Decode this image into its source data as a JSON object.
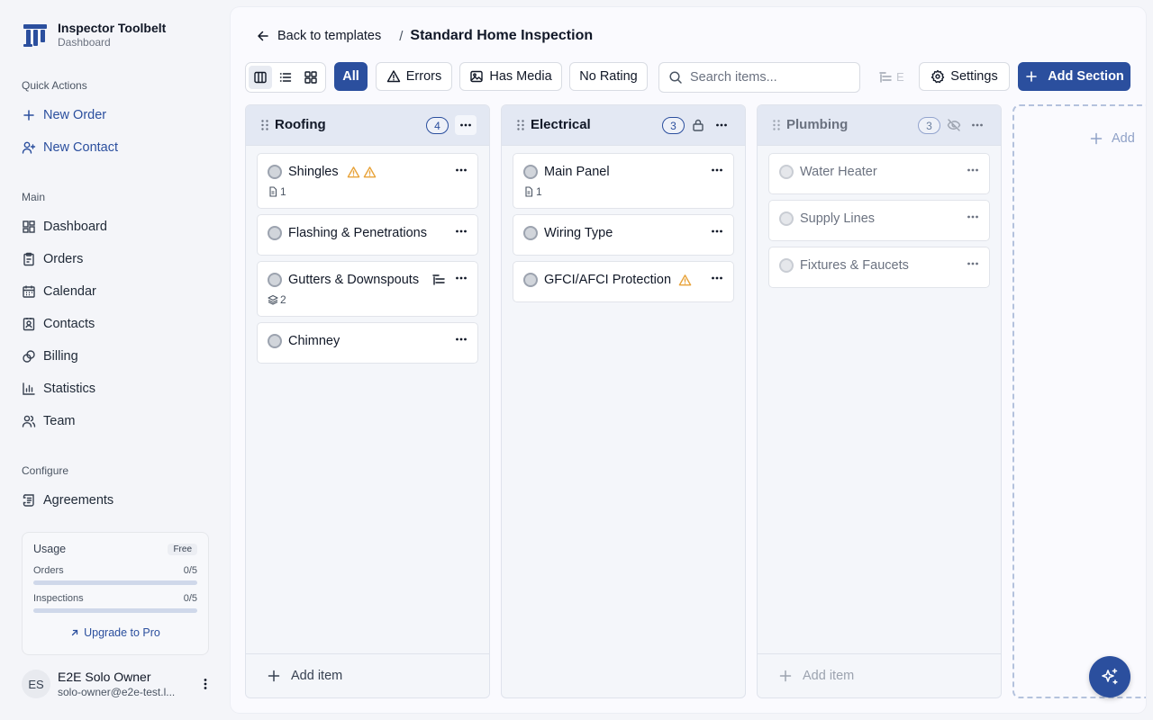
{
  "app": {
    "name": "Inspector Toolbelt",
    "subtitle": "Dashboard"
  },
  "sidebar": {
    "quick_actions_label": "Quick Actions",
    "quick_actions": [
      {
        "label": "New Order",
        "icon": "plus-icon"
      },
      {
        "label": "New Contact",
        "icon": "user-plus-icon"
      }
    ],
    "main_label": "Main",
    "main_items": [
      {
        "label": "Dashboard",
        "icon": "dashboard-icon"
      },
      {
        "label": "Orders",
        "icon": "clipboard-icon"
      },
      {
        "label": "Calendar",
        "icon": "calendar-icon"
      },
      {
        "label": "Contacts",
        "icon": "contact-icon"
      },
      {
        "label": "Billing",
        "icon": "billing-icon"
      },
      {
        "label": "Statistics",
        "icon": "bar-chart-icon"
      },
      {
        "label": "Team",
        "icon": "team-icon"
      }
    ],
    "configure_label": "Configure",
    "configure_items": [
      {
        "label": "Agreements",
        "icon": "scroll-icon"
      }
    ],
    "usage": {
      "title": "Usage",
      "plan": "Free",
      "orders": {
        "label": "Orders",
        "value": "0/5",
        "fraction": 0
      },
      "inspections": {
        "label": "Inspections",
        "value": "0/5",
        "fraction": 0
      },
      "upgrade": "Upgrade to Pro"
    },
    "user": {
      "initials": "ES",
      "name": "E2E Solo Owner",
      "email": "solo-owner@e2e-test.l..."
    }
  },
  "header": {
    "back": "Back to templates",
    "separator": "/",
    "title": "Standard Home Inspection"
  },
  "toolbar": {
    "filters": {
      "all": "All",
      "errors": "Errors",
      "has_media": "Has Media",
      "no_rating": "No Rating"
    },
    "search_placeholder": "Search items...",
    "collapsed_label": "E",
    "settings": "Settings",
    "add_section": "Add Section"
  },
  "sections": [
    {
      "title": "Roofing",
      "count": "4",
      "items": [
        {
          "label": "Shingles",
          "meta": "1"
        },
        {
          "label": "Flashing & Penetrations"
        },
        {
          "label": "Gutters & Downspouts",
          "meta": "2"
        },
        {
          "label": "Chimney"
        }
      ],
      "add_item": "Add item"
    },
    {
      "title": "Electrical",
      "count": "3",
      "items": [
        {
          "label": "Main Panel",
          "meta": "1"
        },
        {
          "label": "Wiring Type"
        },
        {
          "label": "GFCI/AFCI Protection"
        }
      ],
      "add_item": "Add item"
    },
    {
      "title": "Plumbing",
      "count": "3",
      "items": [
        {
          "label": "Water Heater"
        },
        {
          "label": "Supply Lines"
        },
        {
          "label": "Fixtures & Faucets"
        }
      ],
      "add_item": "Add item"
    }
  ],
  "add_column_label": "Add",
  "colors": {
    "accent": "#2b4f9e",
    "warning": "#e8a33a",
    "column_header": "#e3e8f3"
  }
}
